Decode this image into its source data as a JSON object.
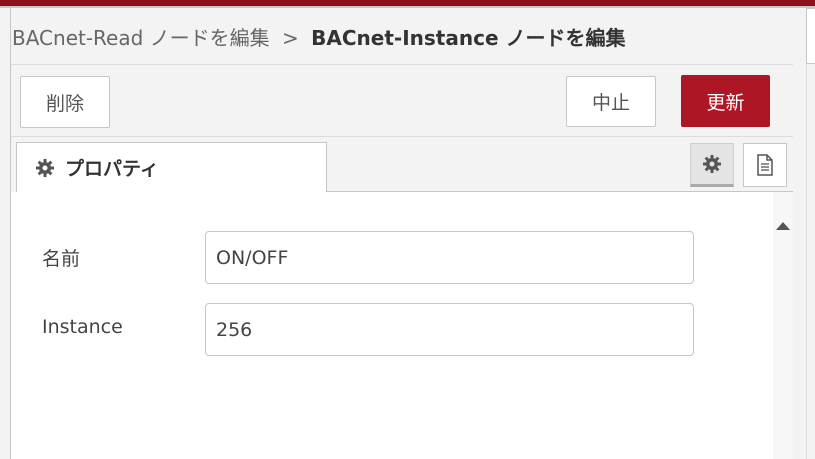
{
  "breadcrumb": {
    "parent": "BACnet-Read ノードを編集",
    "separator": ">",
    "current": "BACnet-Instance ノードを編集"
  },
  "toolbar": {
    "delete_label": "削除",
    "cancel_label": "中止",
    "update_label": "更新"
  },
  "tabs": [
    {
      "label": "プロパティ",
      "icon": "gear-icon"
    }
  ],
  "tab_buttons": [
    {
      "icon": "gear-icon",
      "active": true
    },
    {
      "icon": "document-icon",
      "active": false
    }
  ],
  "form": {
    "name_label": "名前",
    "name_value": "ON/OFF",
    "instance_label": "Instance",
    "instance_value": "256"
  },
  "colors": {
    "accent": "#ad1625",
    "header_bar": "#8c101c"
  }
}
